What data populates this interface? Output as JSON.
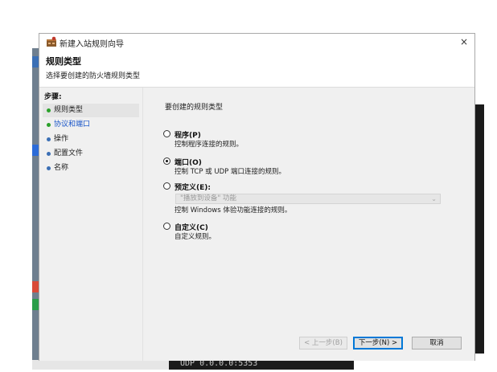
{
  "window": {
    "title": "新建入站规则向导",
    "close": "×"
  },
  "header": {
    "title": "规则类型",
    "subtitle": "选择要创建的防火墙规则类型"
  },
  "sidebar": {
    "steps_label": "步骤:",
    "items": [
      {
        "label": "规则类型"
      },
      {
        "label": "协议和端口"
      },
      {
        "label": "操作"
      },
      {
        "label": "配置文件"
      },
      {
        "label": "名称"
      }
    ]
  },
  "main": {
    "prompt": "要创建的规则类型",
    "options": [
      {
        "label": "程序(P)",
        "desc": "控制程序连接的规则。",
        "checked": false
      },
      {
        "label": "端口(O)",
        "desc": "控制 TCP 或 UDP 端口连接的规则。",
        "checked": true
      },
      {
        "label": "预定义(E):",
        "desc": "控制 Windows 体验功能连接的规则。",
        "checked": false
      },
      {
        "label": "自定义(C)",
        "desc": "自定义规则。",
        "checked": false
      }
    ],
    "predefined_select": "\"播放到设备\" 功能"
  },
  "buttons": {
    "back": "< 上一步(B)",
    "next": "下一步(N) >",
    "cancel": "取消"
  },
  "background": {
    "bottom_text": "UDP   0.0.0.0:5353"
  }
}
